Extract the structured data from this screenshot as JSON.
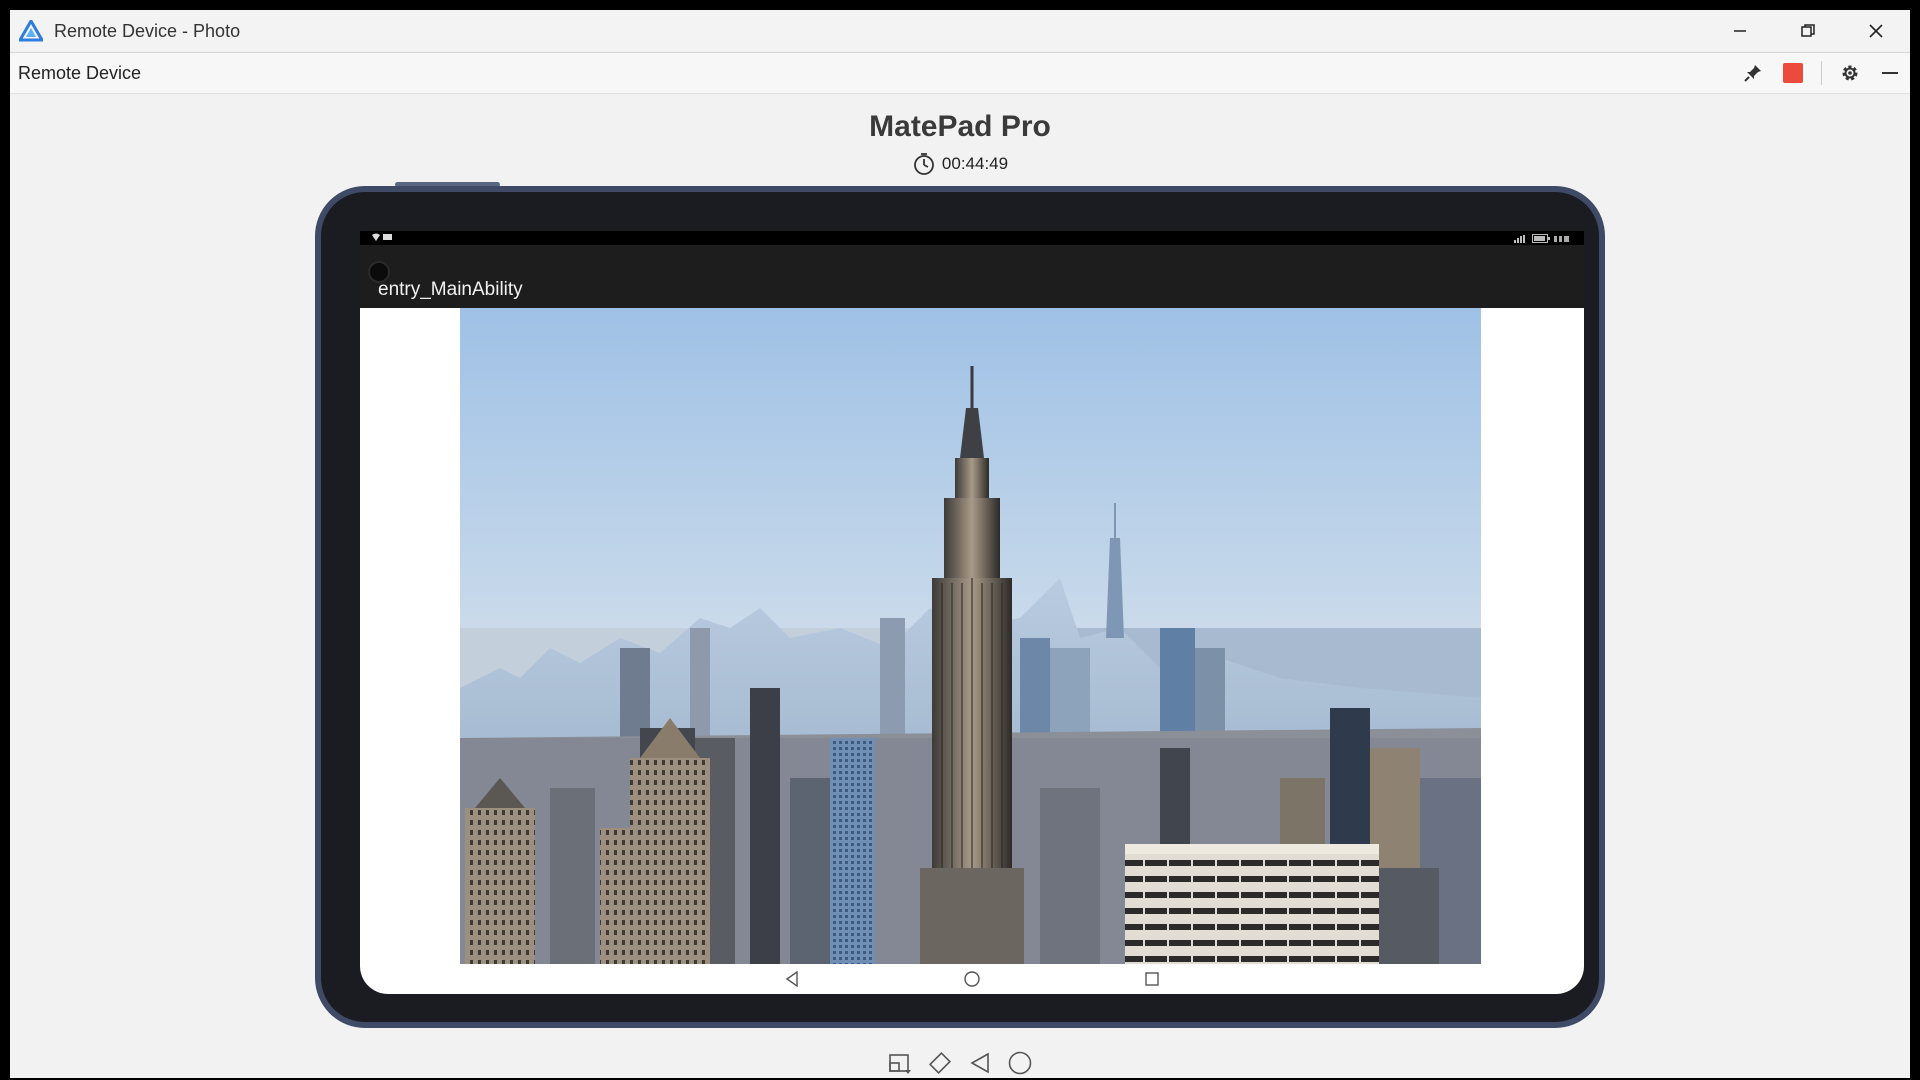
{
  "window": {
    "title": "Remote Device - Photo",
    "controls": [
      "minimize",
      "restore",
      "close"
    ]
  },
  "panel": {
    "title": "Remote Device",
    "tools": [
      "pin-icon",
      "stop-icon",
      "settings-icon",
      "minimize-panel-icon"
    ],
    "stop_color": "#ec4a3b"
  },
  "device": {
    "name": "MatePad Pro",
    "elapsed": "00:44:49"
  },
  "app": {
    "title": "entry_MainAbility",
    "content": "city-skyline-photo"
  },
  "device_nav": [
    "back-icon",
    "home-icon",
    "recents-icon"
  ],
  "bottom_tools": [
    "screenshot-icon",
    "rotate-icon",
    "back-icon",
    "home-icon"
  ],
  "colors": {
    "frame": "#3f4a66",
    "bezel": "#1a1c22",
    "appbar": "#1d1d1d",
    "sky": "#9fc1e6"
  }
}
